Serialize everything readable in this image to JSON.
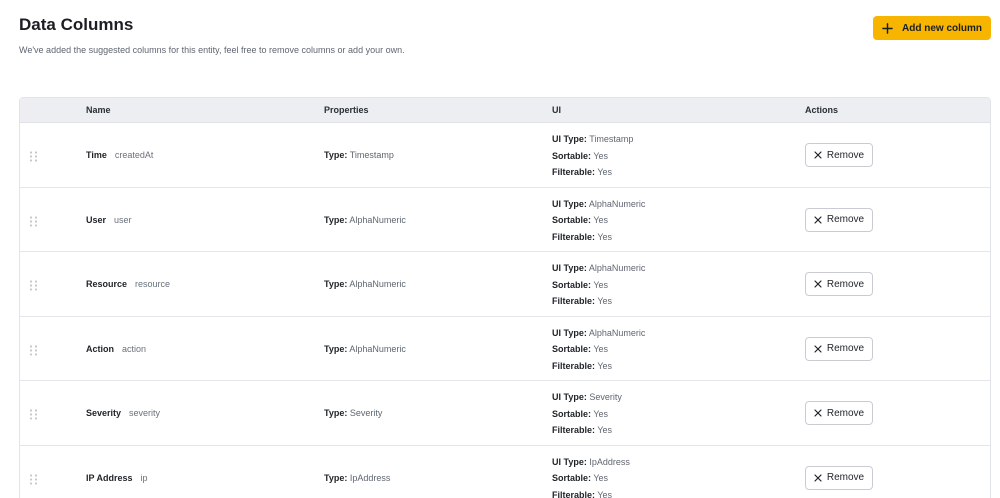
{
  "header": {
    "title": "Data Columns",
    "subtitle": "We've added the suggested columns for this entity, feel free to remove columns or add your own.",
    "add_button_label": "Add new column"
  },
  "table": {
    "columns": [
      "Name",
      "Properties",
      "UI",
      "Actions"
    ],
    "labels": {
      "type": "Type:",
      "ui_type": "UI Type:",
      "sortable": "Sortable:",
      "filterable": "Filterable:",
      "remove": "Remove"
    },
    "rows": [
      {
        "name": "Time",
        "key": "createdAt",
        "type": "Timestamp",
        "ui_type": "Timestamp",
        "sortable": "Yes",
        "filterable": "Yes"
      },
      {
        "name": "User",
        "key": "user",
        "type": "AlphaNumeric",
        "ui_type": "AlphaNumeric",
        "sortable": "Yes",
        "filterable": "Yes"
      },
      {
        "name": "Resource",
        "key": "resource",
        "type": "AlphaNumeric",
        "ui_type": "AlphaNumeric",
        "sortable": "Yes",
        "filterable": "Yes"
      },
      {
        "name": "Action",
        "key": "action",
        "type": "AlphaNumeric",
        "ui_type": "AlphaNumeric",
        "sortable": "Yes",
        "filterable": "Yes"
      },
      {
        "name": "Severity",
        "key": "severity",
        "type": "Severity",
        "ui_type": "Severity",
        "sortable": "Yes",
        "filterable": "Yes"
      },
      {
        "name": "IP Address",
        "key": "ip",
        "type": "IpAddress",
        "ui_type": "IpAddress",
        "sortable": "Yes",
        "filterable": "Yes"
      }
    ]
  },
  "icons": {
    "add": "plus-icon",
    "remove": "close-icon",
    "drag": "drag-handle-icon"
  },
  "colors": {
    "accent": "#f7b500",
    "header_bg": "#eceef1",
    "border": "#e3e6ea"
  }
}
